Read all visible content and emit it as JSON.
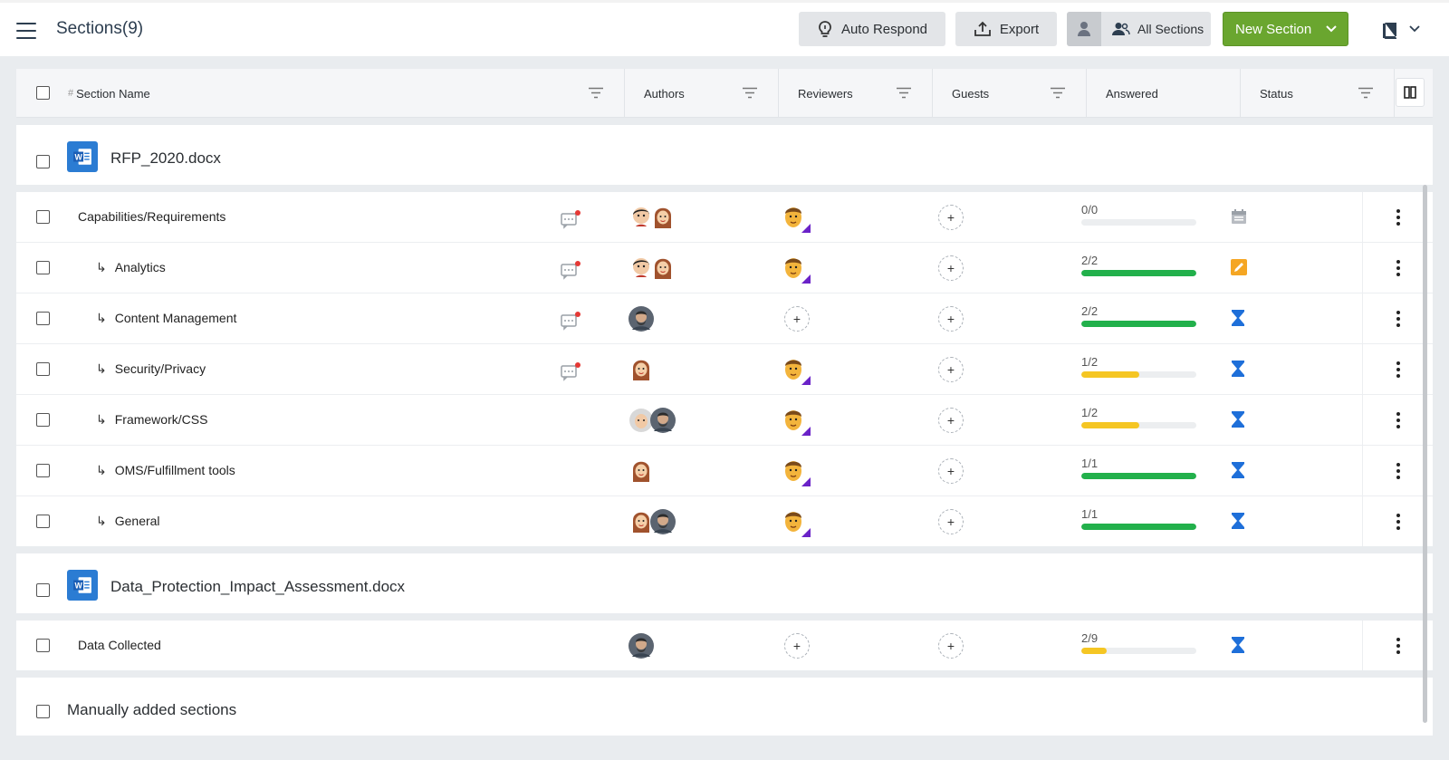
{
  "header": {
    "title": "Sections(9)",
    "auto_respond": "Auto Respond",
    "export": "Export",
    "all_sections": "All Sections",
    "new_section": "New Section"
  },
  "columns": {
    "hash": "#",
    "section_name": "Section Name",
    "authors": "Authors",
    "reviewers": "Reviewers",
    "guests": "Guests",
    "answered": "Answered",
    "status": "Status"
  },
  "files": [
    {
      "name": "RFP_2020.docx",
      "rows": [
        {
          "name": "Capabilities/Requirements",
          "child": false,
          "comment": true,
          "authors": [
            "male-cartoon",
            "female-cartoon"
          ],
          "reviewer": "male-avatar",
          "answered": "0/0",
          "progress": 0,
          "bar_color": "#22b04b",
          "status": "calendar-icon"
        },
        {
          "name": "Analytics",
          "child": true,
          "comment": true,
          "authors": [
            "male-cartoon",
            "female-cartoon"
          ],
          "reviewer": "male-avatar",
          "answered": "2/2",
          "progress": 1.0,
          "bar_color": "#22b04b",
          "status": "edit-icon"
        },
        {
          "name": "Content Management",
          "child": true,
          "comment": true,
          "authors": [
            "photo"
          ],
          "reviewer": "",
          "answered": "2/2",
          "progress": 1.0,
          "bar_color": "#22b04b",
          "status": "hourglass-icon"
        },
        {
          "name": "Security/Privacy",
          "child": true,
          "comment": true,
          "authors": [
            "female-cartoon"
          ],
          "reviewer": "male-avatar",
          "answered": "1/2",
          "progress": 0.5,
          "bar_color": "#f5c623",
          "status": "hourglass-icon"
        },
        {
          "name": "Framework/CSS",
          "child": true,
          "comment": false,
          "authors": [
            "elder-cartoon",
            "photo"
          ],
          "reviewer": "male-avatar",
          "answered": "1/2",
          "progress": 0.5,
          "bar_color": "#f5c623",
          "status": "hourglass-icon"
        },
        {
          "name": "OMS/Fulfillment tools",
          "child": true,
          "comment": false,
          "authors": [
            "female-cartoon"
          ],
          "reviewer": "male-avatar",
          "answered": "1/1",
          "progress": 1.0,
          "bar_color": "#22b04b",
          "status": "hourglass-icon"
        },
        {
          "name": "General",
          "child": true,
          "comment": false,
          "authors": [
            "female-cartoon",
            "photo"
          ],
          "reviewer": "male-avatar",
          "answered": "1/1",
          "progress": 1.0,
          "bar_color": "#22b04b",
          "status": "hourglass-icon"
        }
      ]
    },
    {
      "name": "Data_Protection_Impact_Assessment.docx",
      "rows": [
        {
          "name": "Data Collected",
          "child": false,
          "comment": false,
          "authors": [
            "photo"
          ],
          "reviewer": "",
          "answered": "2/9",
          "progress": 0.22,
          "bar_color": "#f5c623",
          "status": "hourglass-icon"
        }
      ]
    }
  ],
  "manual": {
    "name": "Manually added sections"
  },
  "colors": {
    "accent_green": "#6aa62f",
    "word_blue": "#2b7cd3",
    "status_blue": "#1e6fd9",
    "status_orange": "#f5a623"
  }
}
